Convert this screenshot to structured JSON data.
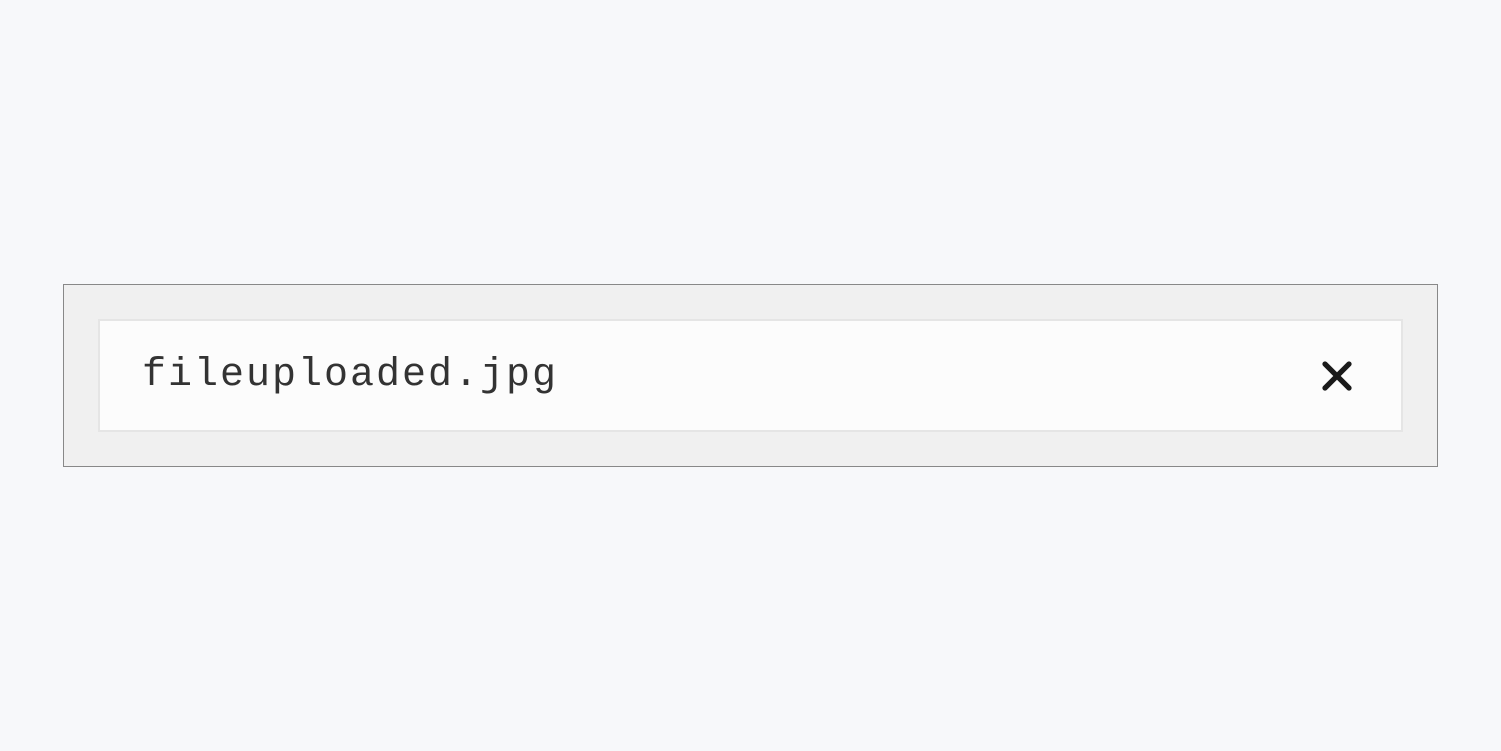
{
  "file": {
    "name": "fileuploaded.jpg"
  }
}
